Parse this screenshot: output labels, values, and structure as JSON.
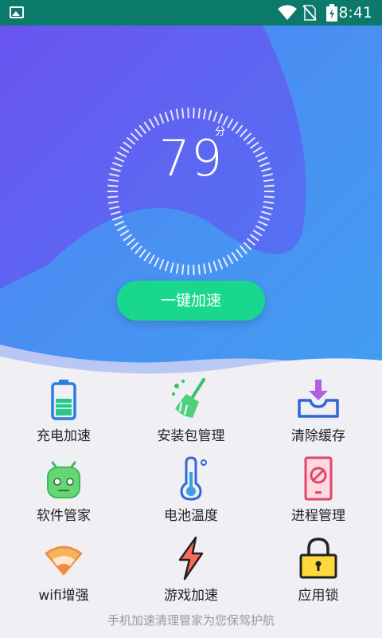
{
  "status": {
    "time": "8:41"
  },
  "hero": {
    "score": "79",
    "score_unit": "分",
    "boost_label": "一键加速"
  },
  "features": [
    {
      "label": "充电加速",
      "icon": "battery-icon"
    },
    {
      "label": "安装包管理",
      "icon": "broom-icon"
    },
    {
      "label": "清除缓存",
      "icon": "inbox-download-icon"
    },
    {
      "label": "软件管家",
      "icon": "android-robot-icon"
    },
    {
      "label": "电池温度",
      "icon": "thermometer-icon"
    },
    {
      "label": "进程管理",
      "icon": "phone-block-icon"
    },
    {
      "label": "wifi增强",
      "icon": "wifi-signal-icon"
    },
    {
      "label": "游戏加速",
      "icon": "lightning-icon"
    },
    {
      "label": "应用锁",
      "icon": "lock-icon"
    }
  ],
  "footer": {
    "text": "手机加速清理管家为您保驾护航"
  },
  "colors": {
    "status_bar": "#0b7a6a",
    "accent_green": "#19d88e",
    "hero_blue": "#4a7cf5",
    "hero_purple": "#5f5af0"
  }
}
